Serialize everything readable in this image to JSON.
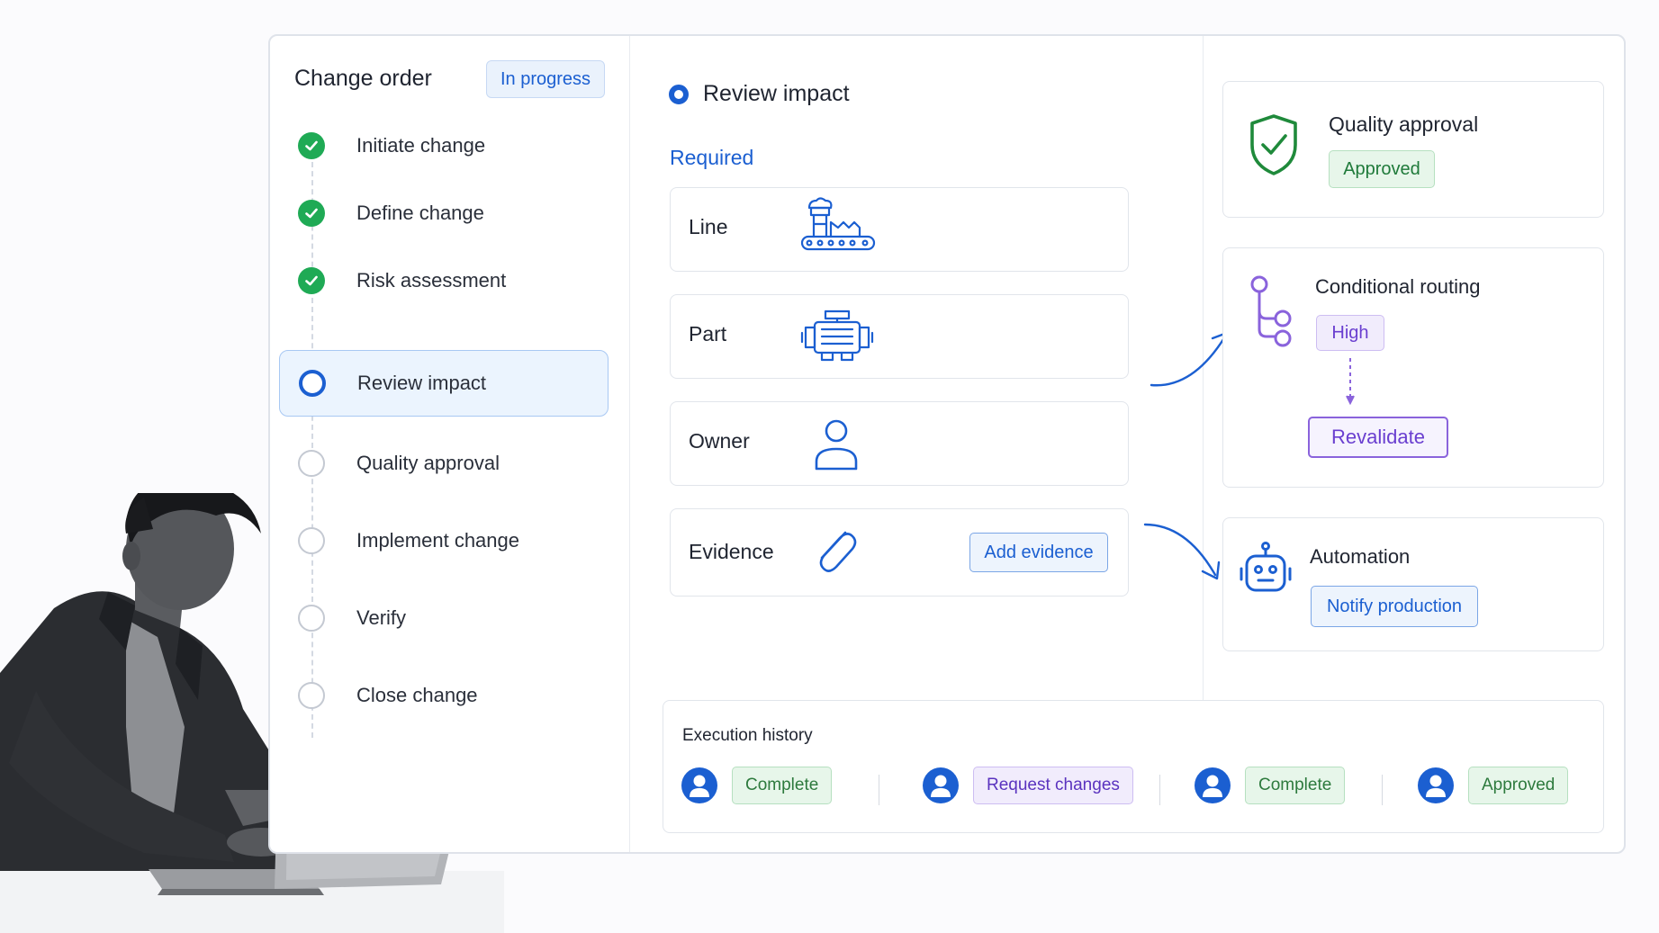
{
  "change_order": {
    "title": "Change order",
    "status": "In progress",
    "steps": [
      {
        "label": "Initiate change",
        "state": "done"
      },
      {
        "label": "Define change",
        "state": "done"
      },
      {
        "label": "Risk assessment",
        "state": "done"
      },
      {
        "label": "Review impact",
        "state": "current"
      },
      {
        "label": "Quality approval",
        "state": "todo"
      },
      {
        "label": "Implement change",
        "state": "todo"
      },
      {
        "label": "Verify",
        "state": "todo"
      },
      {
        "label": "Close change",
        "state": "todo"
      }
    ]
  },
  "review_impact": {
    "title": "Review impact",
    "required_label": "Required",
    "items": [
      {
        "label": "Line",
        "icon": "production-line-icon"
      },
      {
        "label": "Part",
        "icon": "engine-part-icon"
      },
      {
        "label": "Owner",
        "icon": "user-icon"
      },
      {
        "label": "Evidence",
        "icon": "paperclip-icon",
        "action": "Add evidence"
      }
    ]
  },
  "quality_approval": {
    "title": "Quality approval",
    "status": "Approved",
    "icon": "shield-check-icon"
  },
  "conditional_routing": {
    "title": "Conditional routing",
    "level": "High",
    "action": "Revalidate",
    "icon": "branch-icon"
  },
  "automation": {
    "title": "Automation",
    "action": "Notify production",
    "icon": "robot-icon"
  },
  "execution_history": {
    "title": "Execution history",
    "entries": [
      {
        "status": "Complete",
        "variant": "green"
      },
      {
        "status": "Request changes",
        "variant": "purple"
      },
      {
        "status": "Complete",
        "variant": "green"
      },
      {
        "status": "Approved",
        "variant": "green"
      }
    ]
  },
  "colors": {
    "accent": "#1b5fd1",
    "success": "#1faa55",
    "purple": "#6a3fd0"
  }
}
